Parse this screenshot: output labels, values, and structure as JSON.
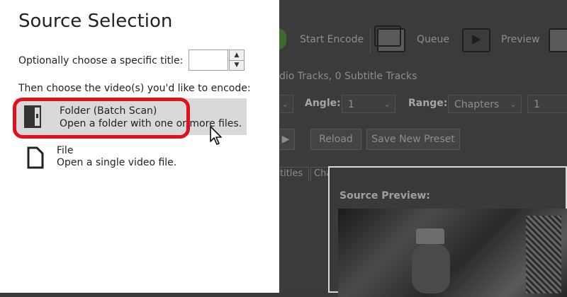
{
  "background_app": {
    "toolbar": {
      "start_encode": "Start Encode",
      "queue": "Queue",
      "preview": "Preview"
    },
    "tracks_info": "dio Tracks, 0 Subtitle Tracks",
    "angle": {
      "label": "Angle:",
      "value": "1"
    },
    "range": {
      "label": "Range:",
      "value": "Chapters",
      "start": "1"
    },
    "buttons": {
      "reload": "Reload",
      "save_new_preset": "Save New Preset"
    },
    "tabs": [
      "titles",
      "Chapters"
    ],
    "source_preview_title": "Source Preview:"
  },
  "source_selection": {
    "title": "Source Selection",
    "title_option_label": "Optionally choose a specific title:",
    "title_option_value": "",
    "choose_label": "Then choose the video(s) you'd like to encode:",
    "options": [
      {
        "name": "Folder (Batch Scan)",
        "description": "Open a folder with one or more files.",
        "icon": "folder-icon",
        "selected": true
      },
      {
        "name": "File",
        "description": "Open a single video file.",
        "icon": "file-icon",
        "selected": false
      }
    ]
  },
  "colors": {
    "highlight": "#e0101c",
    "selected_bg": "#d9d9d9",
    "dim_overlay": "#3b3b3b"
  }
}
